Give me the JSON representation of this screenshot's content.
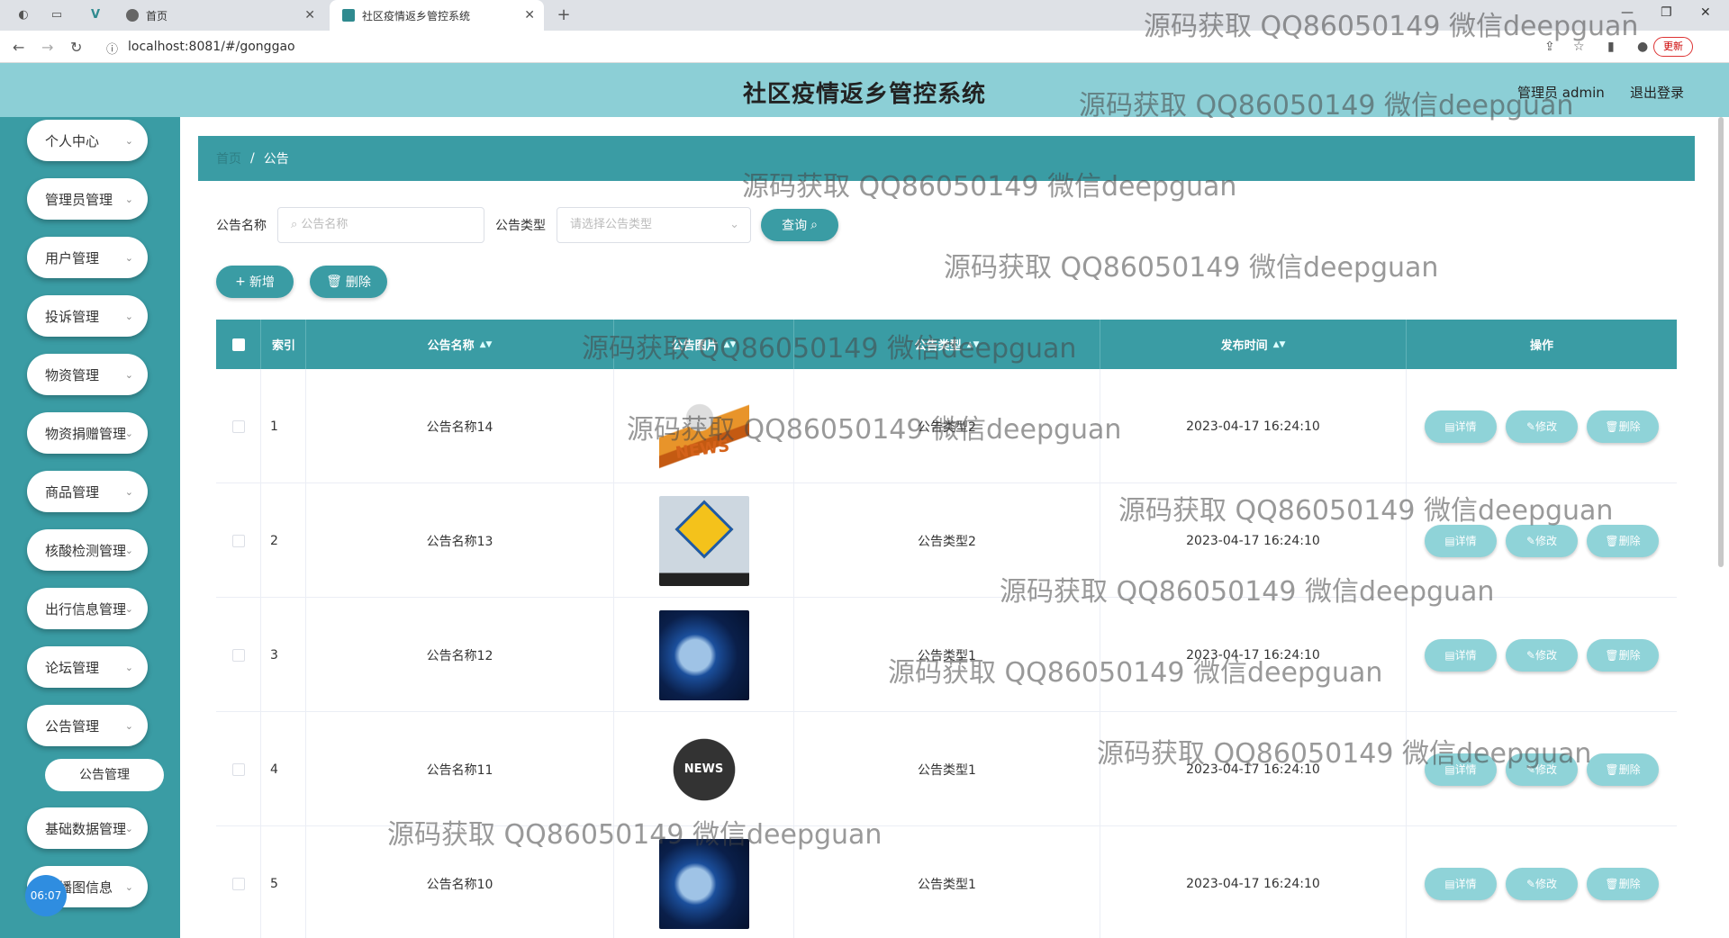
{
  "browser": {
    "tabs": [
      {
        "label": "首页",
        "active": false
      },
      {
        "label": "社区疫情返乡管控系统",
        "active": true
      }
    ],
    "url": "localhost:8081/#/gonggao",
    "update_label": "更新"
  },
  "header": {
    "title": "社区疫情返乡管控系统",
    "user": "管理员 admin",
    "logout": "退出登录"
  },
  "sidebar": {
    "items": [
      {
        "label": "个人中心"
      },
      {
        "label": "管理员管理"
      },
      {
        "label": "用户管理"
      },
      {
        "label": "投诉管理"
      },
      {
        "label": "物资管理"
      },
      {
        "label": "物资捐赠管理"
      },
      {
        "label": "商品管理"
      },
      {
        "label": "核酸检测管理"
      },
      {
        "label": "出行信息管理"
      },
      {
        "label": "论坛管理"
      },
      {
        "label": "公告管理"
      },
      {
        "label": "基础数据管理"
      },
      {
        "label": "轮播图信息"
      }
    ],
    "sub_item": "公告管理",
    "clock": "06:07"
  },
  "breadcrumb": {
    "home": "首页",
    "current": "公告"
  },
  "filters": {
    "name_label": "公告名称",
    "name_placeholder": "公告名称",
    "type_label": "公告类型",
    "type_placeholder": "请选择公告类型",
    "query_label": "查询"
  },
  "actions": {
    "add": "新增",
    "delete": "删除"
  },
  "table": {
    "columns": [
      "索引",
      "公告名称",
      "公告图片",
      "公告类型",
      "发布时间",
      "操作"
    ],
    "rows": [
      {
        "index": "1",
        "name": "公告名称14",
        "type": "公告类型2",
        "time": "2023-04-17 16:24:10",
        "image": "news-3d-man"
      },
      {
        "index": "2",
        "name": "公告名称13",
        "type": "公告类型2",
        "time": "2023-04-17 16:24:10",
        "image": "breaking-news-sign"
      },
      {
        "index": "3",
        "name": "公告名称12",
        "type": "公告类型1",
        "time": "2023-04-17 16:24:10",
        "image": "globe-blue"
      },
      {
        "index": "4",
        "name": "公告名称11",
        "type": "公告类型1",
        "time": "2023-04-17 16:24:10",
        "image": "news-globe-badge"
      },
      {
        "index": "5",
        "name": "公告名称10",
        "type": "公告类型1",
        "time": "2023-04-17 16:24:10",
        "image": "globe-blue"
      }
    ],
    "op_labels": {
      "detail": "详情",
      "edit": "修改",
      "delete": "删除"
    }
  },
  "watermark": "源码获取 QQ86050149 微信deepguan",
  "colors": {
    "teal": "#3a9ca4",
    "header": "#8ccfd6",
    "op_button": "#8fd3d8"
  }
}
